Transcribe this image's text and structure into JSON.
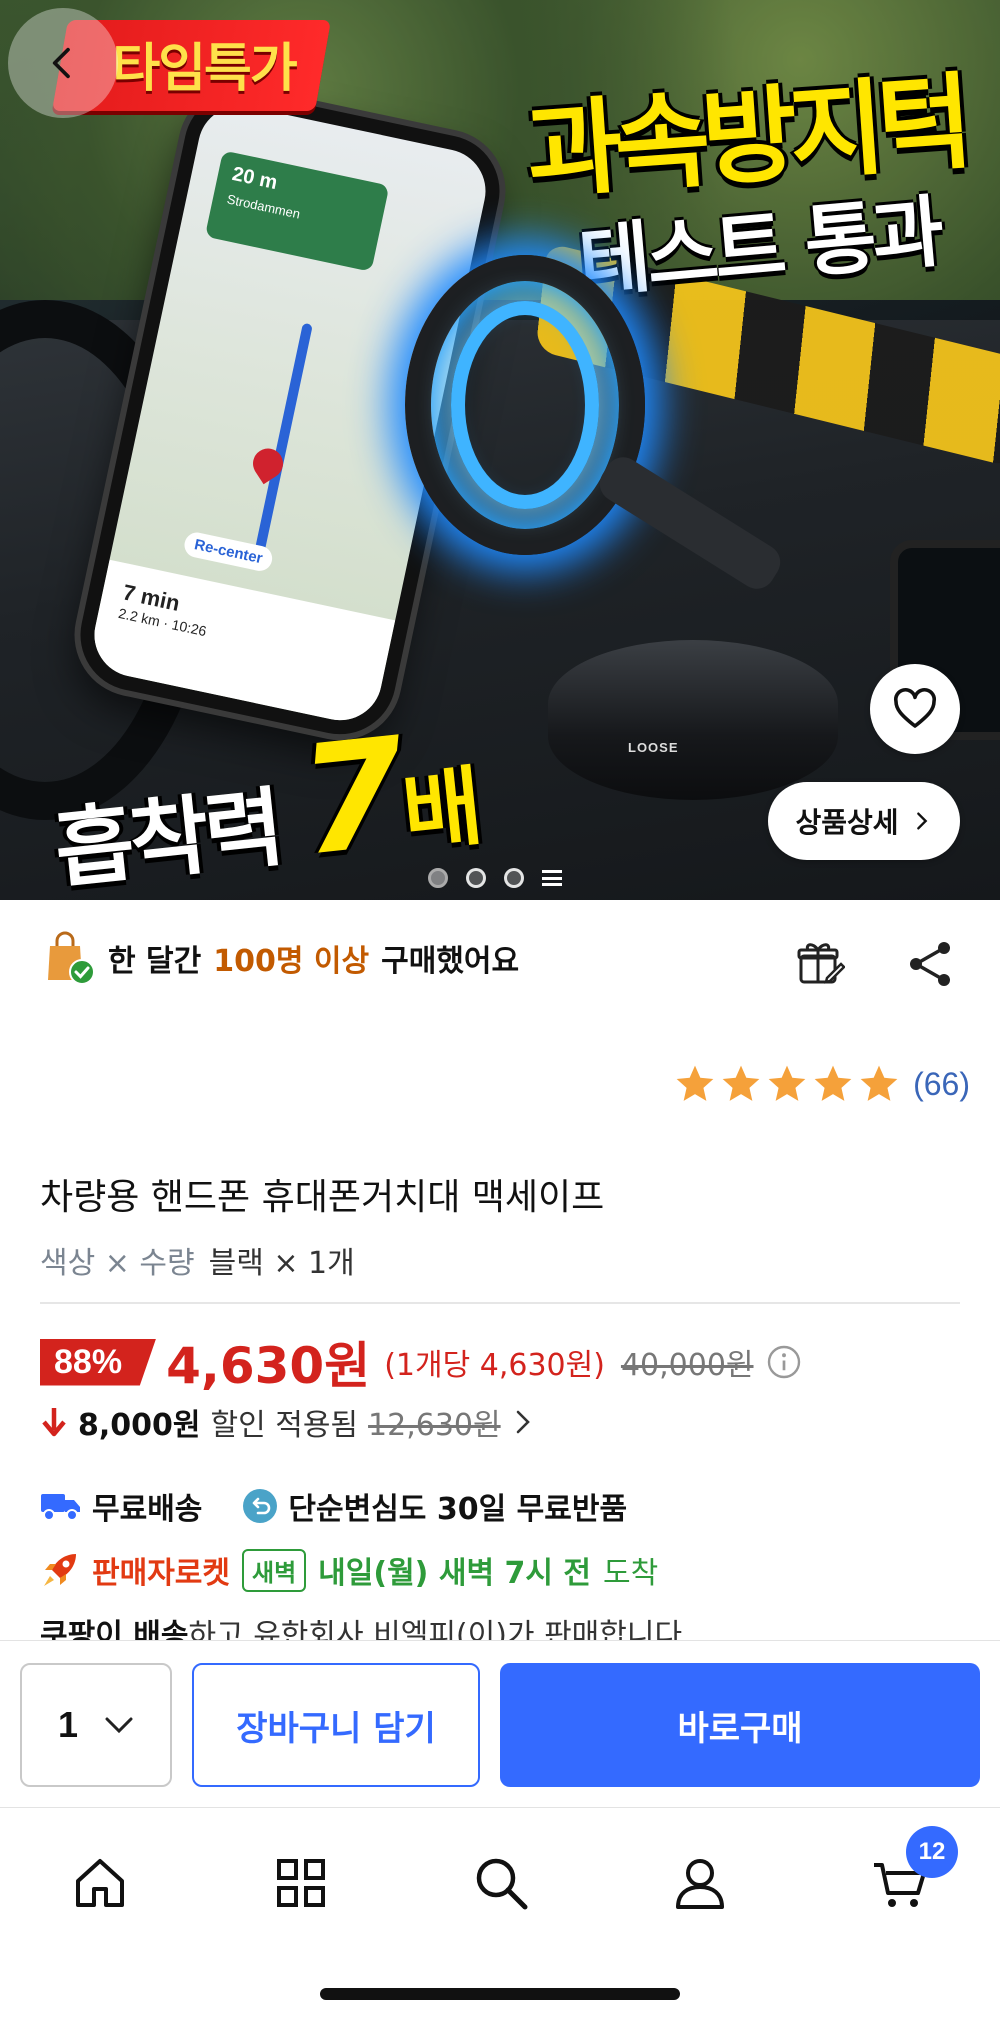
{
  "hero": {
    "time_sale": "타임특가",
    "headline_main": "과속방지턱",
    "headline_sub": "테스트 통과",
    "suction_label": "흡착력",
    "suction_value": "7",
    "suction_unit": "배",
    "detail_button": "상품상세",
    "carousel": {
      "count": 3,
      "active": 0
    },
    "phone": {
      "nav_distance": "20 m",
      "nav_street": "Strodammen",
      "recenter": "Re-center",
      "eta": "7 min",
      "eta_detail": "2.2 km · 10:26"
    },
    "mount_label": "LOOSE"
  },
  "purchase_info": {
    "prefix": "한 달간",
    "highlight": "100명 이상",
    "suffix": "구매했어요"
  },
  "rating": {
    "stars": 5,
    "count": "(66)"
  },
  "product": {
    "title": "차량용 핸드폰 휴대폰거치대 맥세이프",
    "option_label": "색상 × 수량",
    "option_value": "블랙 × 1개"
  },
  "price": {
    "discount_rate": "88%",
    "sale_price": "4,630원",
    "unit_price": "(1개당 4,630원)",
    "original_price": "40,000원",
    "coupon_amount": "8,000원",
    "coupon_text": "할인 적용됨",
    "pre_coupon_price": "12,630원"
  },
  "shipping": {
    "free_shipping": "무료배송",
    "free_return": "단순변심도 30일 무료반품",
    "seller_rocket": "판매자로켓",
    "dawn_badge": "새벽",
    "delivery_time": "내일(월) 새벽 7시 전",
    "arrive": "도착",
    "seller_bold": "쿠팡이 배송",
    "seller_text": "하고 유한회사 비엘피(이)가 판매합니다"
  },
  "actions": {
    "quantity": "1",
    "add_to_cart": "장바구니 담기",
    "buy_now": "바로구매"
  },
  "tabbar": {
    "cart_badge": "12"
  },
  "colors": {
    "primary_blue": "#346aff",
    "sale_red": "#d3231d",
    "star_orange": "#f5a13a",
    "highlight_orange": "#c25a00",
    "dawn_green": "#2e9b3a"
  }
}
